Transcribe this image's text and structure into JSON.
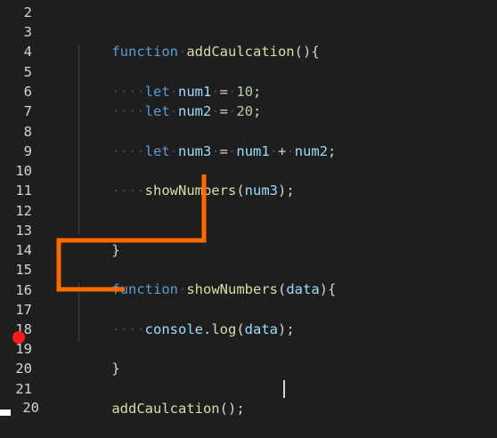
{
  "editor": {
    "line_numbers": [
      "2",
      "3",
      "4",
      "5",
      "6",
      "7",
      "8",
      "9",
      "10",
      "11",
      "12",
      "13",
      "14",
      "15",
      "16",
      "17",
      "18",
      "19",
      "20",
      "21",
      "20"
    ],
    "lines": {
      "l3": {
        "kw": "function",
        "fn": "addCaulcation",
        "rest": "(){"
      },
      "l5": {
        "kw": "let",
        "var": "num1",
        "op": "=",
        "num": "10",
        "end": ";"
      },
      "l6": {
        "kw": "let",
        "var": "num2",
        "op": "=",
        "num": "20",
        "end": ";"
      },
      "l8": {
        "kw": "let",
        "var": "num3",
        "op": "=",
        "a": "num1",
        "plus": "+",
        "b": "num2",
        "end": ";"
      },
      "l10": {
        "fn": "showNumbers",
        "open": "(",
        "arg": "num3",
        "close": ");"
      },
      "l13": {
        "text": "}"
      },
      "l15": {
        "kw": "function",
        "fn": "showNumbers",
        "open": "(",
        "arg": "data",
        "close": "){"
      },
      "l17": {
        "obj": "console",
        "dot": ".",
        "fn": "log",
        "open": "(",
        "arg": "data",
        "close": ");"
      },
      "l19": {
        "text": "}"
      },
      "l21": {
        "fn": "addCaulcation",
        "rest": "();"
      }
    },
    "whitespace_marker": "····",
    "breakpoint_line": "19"
  },
  "colors": {
    "background": "#1e1e1e",
    "keyword": "#569cd6",
    "function": "#dcdcaa",
    "variable": "#9cdcfe",
    "number": "#b5cea8",
    "annotation": "#ff6a00",
    "breakpoint": "#ff1a1a"
  }
}
